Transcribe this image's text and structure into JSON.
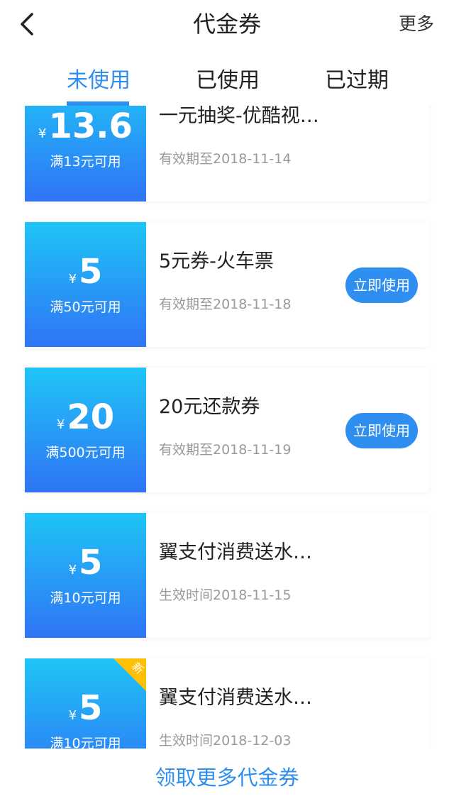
{
  "nav": {
    "back_icon": "chevron-left-icon",
    "title": "代金券",
    "more": "更多"
  },
  "tabs": [
    {
      "label": "未使用",
      "active": true
    },
    {
      "label": "已使用",
      "active": false
    },
    {
      "label": "已过期",
      "active": false
    }
  ],
  "colors": {
    "accent": "#2f8ff0",
    "coupon_gradient_top": "#1fc5f7",
    "coupon_gradient_bottom": "#2f74f5",
    "new_badge": "#ffc107"
  },
  "coupons": [
    {
      "currency": "¥",
      "amount": "13.6",
      "condition": "满13元可用",
      "name": "一元抽奖-优酷视…",
      "date": "有效期至2018-11-14",
      "action": "",
      "badge": ""
    },
    {
      "currency": "¥",
      "amount": "5",
      "condition": "满50元可用",
      "name": "5元券-火车票",
      "date": "有效期至2018-11-18",
      "action": "立即使用",
      "badge": ""
    },
    {
      "currency": "¥",
      "amount": "20",
      "condition": "满500元可用",
      "name": "20元还款券",
      "date": "有效期至2018-11-19",
      "action": "立即使用",
      "badge": ""
    },
    {
      "currency": "¥",
      "amount": "5",
      "condition": "满10元可用",
      "name": "翼支付消费送水…",
      "date": "生效时间2018-11-15",
      "action": "",
      "badge": ""
    },
    {
      "currency": "¥",
      "amount": "5",
      "condition": "满10元可用",
      "name": "翼支付消费送水…",
      "date": "生效时间2018-12-03",
      "action": "",
      "badge": "新"
    }
  ],
  "footer": {
    "link": "领取更多代金券"
  }
}
